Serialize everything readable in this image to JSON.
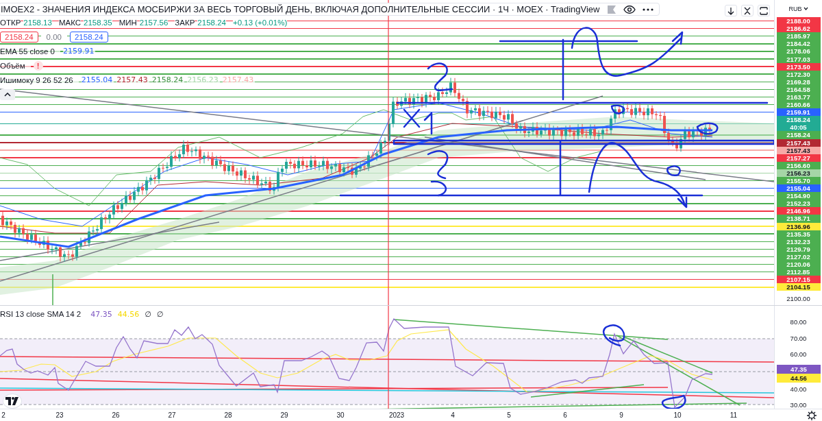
{
  "title": "IMOEX2 - ЗНАЧЕНИЯ ИНДЕКСА МОСБИРЖИ ЗА ВЕСЬ ТОРГОВЫЙ ДЕНЬ, ВКЛЮЧАЯ ДОПОЛНИТЕЛЬНЫЕ СЕССИИ · 1Ч · MOEX · TradingView",
  "price_legend": {
    "fields": [
      {
        "label": "ОТКР",
        "value": "2158.13"
      },
      {
        "label": "МАКС",
        "value": "2158.35"
      },
      {
        "label": "МИН",
        "value": "2157.56"
      },
      {
        "label": "ЗАКР",
        "value": "2158.24"
      }
    ],
    "change": "+0.13 (+0.01%)"
  },
  "symbol_row": [
    {
      "kind": "tag",
      "text": "2158.24",
      "color": "#f23645"
    },
    {
      "kind": "plain",
      "text": "0.00",
      "color": "#787b86"
    },
    {
      "kind": "tag",
      "text": "2158.24",
      "color": "#2962ff"
    }
  ],
  "indicators": [
    {
      "name": "EMA 55 close 0",
      "values": [
        {
          "text": "2159.91",
          "color": "#2962ff"
        }
      ]
    },
    {
      "name": "Объём",
      "warning": "!"
    },
    {
      "name": "Ишимоку 9 26 52 26",
      "values": [
        {
          "text": "2155.04",
          "color": "#2962ff"
        },
        {
          "text": "2157.43",
          "color": "#b22833"
        },
        {
          "text": "2158.24",
          "color": "#388e3c"
        },
        {
          "text": "2156.23",
          "color": "#a5d6a7"
        },
        {
          "text": "2157.43",
          "color": "#f7a9a7"
        }
      ]
    }
  ],
  "price_scale": {
    "currency": "RUB",
    "tags": [
      {
        "text": "2188.00",
        "color": "#f23645"
      },
      {
        "text": "2186.62",
        "color": "#f23645"
      },
      {
        "text": "2185.97",
        "color": "#4caf50"
      },
      {
        "text": "2184.42",
        "color": "#4caf50"
      },
      {
        "text": "2178.06",
        "color": "#4caf50"
      },
      {
        "text": "2177.03",
        "color": "#4caf50"
      },
      {
        "text": "2173.50",
        "color": "#f23645"
      },
      {
        "text": "2172.30",
        "color": "#4caf50"
      },
      {
        "text": "2169.28",
        "color": "#4caf50"
      },
      {
        "text": "2164.58",
        "color": "#4caf50"
      },
      {
        "text": "2163.77",
        "color": "#4caf50"
      },
      {
        "text": "2160.66",
        "color": "#4caf50"
      },
      {
        "text": "2159.91",
        "color": "#2962ff"
      },
      {
        "text": "2158.24",
        "sub": "40:05",
        "color": "#22ab94"
      },
      {
        "text": "2158.24",
        "color": "#4caf50"
      },
      {
        "text": "2157.43",
        "color": "#b22833"
      },
      {
        "text": "2157.43",
        "color": "#f7a9a7"
      },
      {
        "text": "2157.27",
        "color": "#f23645"
      },
      {
        "text": "2156.60",
        "color": "#4caf50"
      },
      {
        "text": "2156.23",
        "color": "#a5d6a7"
      },
      {
        "text": "2155.70",
        "color": "#4caf50"
      },
      {
        "text": "2155.04",
        "color": "#2962ff"
      },
      {
        "text": "2154.90",
        "color": "#4caf50"
      },
      {
        "text": "2152.23",
        "color": "#4caf50"
      },
      {
        "text": "2146.96",
        "color": "#f23645"
      },
      {
        "text": "2138.71",
        "color": "#4caf50"
      },
      {
        "text": "2136.96",
        "color": "#ffeb3b"
      },
      {
        "text": "2135.35",
        "color": "#4caf50"
      },
      {
        "text": "2132.23",
        "color": "#4caf50"
      },
      {
        "text": "2129.79",
        "color": "#4caf50"
      },
      {
        "text": "2127.02",
        "color": "#4caf50"
      },
      {
        "text": "2120.06",
        "color": "#4caf50"
      },
      {
        "text": "2112.85",
        "color": "#4caf50"
      },
      {
        "text": "2107.15",
        "color": "#f23645"
      },
      {
        "text": "2104.15",
        "color": "#ffeb3b"
      }
    ],
    "label": "2100.00"
  },
  "rsi": {
    "name": "RSI 13 close SMA 14 2",
    "values": [
      {
        "text": "47.35",
        "color": "#7e57c2"
      },
      {
        "text": "44.56",
        "color": "#f5d800"
      },
      {
        "text": "∅"
      },
      {
        "text": "∅"
      }
    ]
  },
  "rsi_scale": {
    "labels": [
      "80.00",
      "70.00",
      "60.00",
      "40.00",
      "30.00"
    ],
    "tags": [
      {
        "text": "47.35",
        "color": "#7e57c2"
      },
      {
        "text": "44.56",
        "color": "#ffeb3b"
      }
    ]
  },
  "time_axis": [
    "2",
    "23",
    "26",
    "27",
    "28",
    "29",
    "30",
    "2023",
    "4",
    "5",
    "6",
    "9",
    "10",
    "11"
  ]
}
